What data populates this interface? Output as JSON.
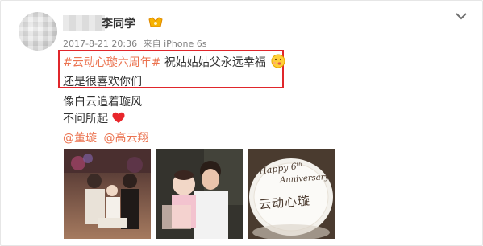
{
  "post": {
    "username": "李同学",
    "time": "2017-8-21 20:36",
    "source_prefix": "来自",
    "source": "iPhone 6s",
    "hashtag": "#云动心璇六周年#",
    "line1_text": "祝姑姑姑父永远幸福",
    "line2": "还是很喜欢你们",
    "line3": "像白云追着璇风",
    "line4": "不问所起",
    "mentions": [
      "@董璇",
      "@高云翔"
    ],
    "cake_text_1": "Happy 6ᵗʰ",
    "cake_text_2": "Anniversary",
    "cake_text_3": "云动心璇"
  },
  "colors": {
    "link": "#eb7350",
    "highlight_border": "#e0262b",
    "text": "#333333",
    "meta": "#808080"
  },
  "icons": [
    "vip-badge-icon",
    "chevron-down-icon",
    "kiss-face-emoji-icon",
    "red-heart-emoji-icon"
  ]
}
